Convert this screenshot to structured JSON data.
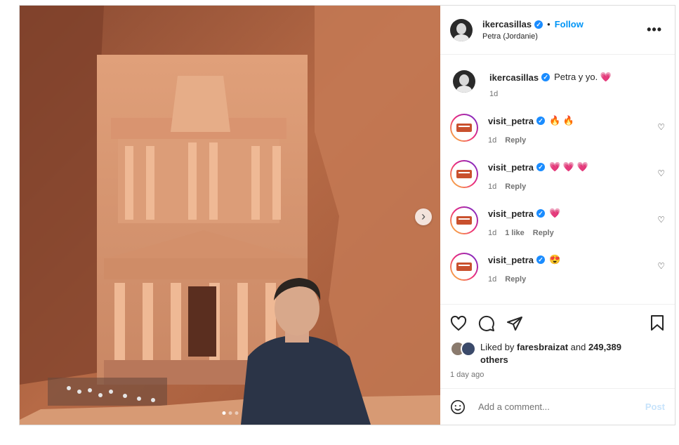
{
  "post": {
    "username": "ikercasillas",
    "follow_label": "Follow",
    "separator": "•",
    "location": "Petra (Jordanie)",
    "more_icon": "more-horizontal-icon"
  },
  "comments": [
    {
      "user": "ikercasillas",
      "text": "Petra y yo. 💗",
      "meta": [
        "1d"
      ],
      "owner": true
    },
    {
      "user": "visit_petra",
      "text": "🔥 🔥",
      "meta": [
        "1d",
        "Reply"
      ]
    },
    {
      "user": "visit_petra",
      "text": "💗 💗 💗",
      "meta": [
        "1d",
        "Reply"
      ]
    },
    {
      "user": "visit_petra",
      "text": "💗",
      "meta": [
        "1d",
        "1 like",
        "Reply"
      ]
    },
    {
      "user": "visit_petra",
      "text": "😍",
      "meta": [
        "1d",
        "Reply"
      ]
    }
  ],
  "likes": {
    "prefix": "Liked by ",
    "user": "faresbraizat",
    "middle": " and ",
    "count": "249,389",
    "suffix": " others"
  },
  "time_ago": "1 day ago",
  "add_comment": {
    "placeholder": "Add a comment...",
    "post_label": "Post"
  },
  "carousel": {
    "current": 1,
    "total": 3
  },
  "colors": {
    "follow": "#0095f6",
    "verified": "#1a8cff",
    "post_disabled": "#c7e3fb"
  }
}
